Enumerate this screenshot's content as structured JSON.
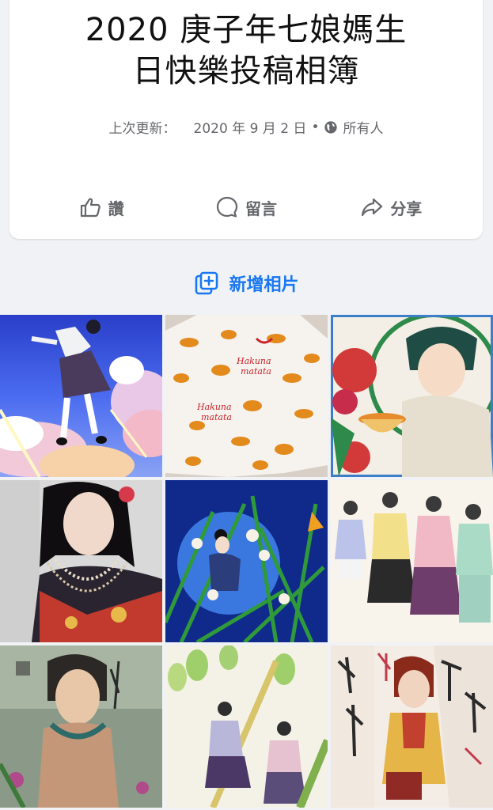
{
  "album": {
    "title_line1": "2020 庚子年七娘媽生",
    "title_line2": "日快樂投稿相簿",
    "updated_label": "上次更新：",
    "updated_date": "2020 年 9 月 2 日",
    "separator": "•",
    "privacy": "所有人",
    "privacy_icon": "globe-icon"
  },
  "actions": {
    "like_label": "讚",
    "comment_label": "留言",
    "share_label": "分享"
  },
  "add_photos": {
    "label": "新增相片",
    "icon": "add-photo-icon"
  },
  "colors": {
    "accent": "#1877f2",
    "secondary_text": "#65676b",
    "title_text": "#111111",
    "background": "#f0f2f5",
    "card": "#ffffff"
  },
  "photos": [
    {
      "name": "photo-girl-jumping-sky"
    },
    {
      "name": "photo-tiger-print-shirt",
      "text_lines": [
        "Hakuna",
        "matata"
      ]
    },
    {
      "name": "photo-woman-holding-bowl-flowers"
    },
    {
      "name": "photo-doll-embroidered-dress"
    },
    {
      "name": "photo-girl-in-grass"
    },
    {
      "name": "photo-four-women-group"
    },
    {
      "name": "photo-woman-with-calligraphy"
    },
    {
      "name": "photo-two-women-bamboo"
    },
    {
      "name": "photo-woman-democracy-banners"
    }
  ]
}
